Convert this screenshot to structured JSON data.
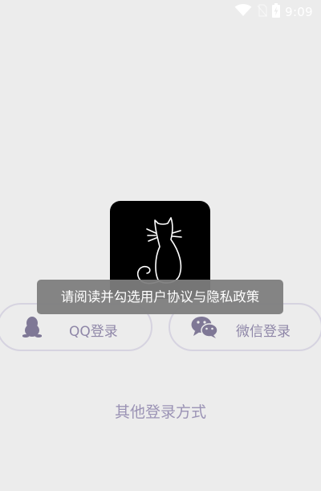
{
  "status_bar": {
    "time": "9:09",
    "icons": [
      "wifi-icon",
      "no-sim-icon",
      "battery-charging-icon"
    ],
    "icon_color": "#ffffff"
  },
  "logo": {
    "icon": "cat-silhouette-icon",
    "background": "#000000"
  },
  "login_options": {
    "qq": {
      "label": "QQ登录",
      "icon": "qq-penguin-icon"
    },
    "wechat": {
      "label": "微信登录",
      "icon": "wechat-icon"
    }
  },
  "other_login_label": "其他登录方式",
  "toast": {
    "message": "请阅读并勾选用户协议与隐私政策"
  },
  "colors": {
    "background": "#ececec",
    "accent_text": "#8f87a8",
    "button_border": "#d6d3e0",
    "toast_background": "#7d7d7d"
  }
}
